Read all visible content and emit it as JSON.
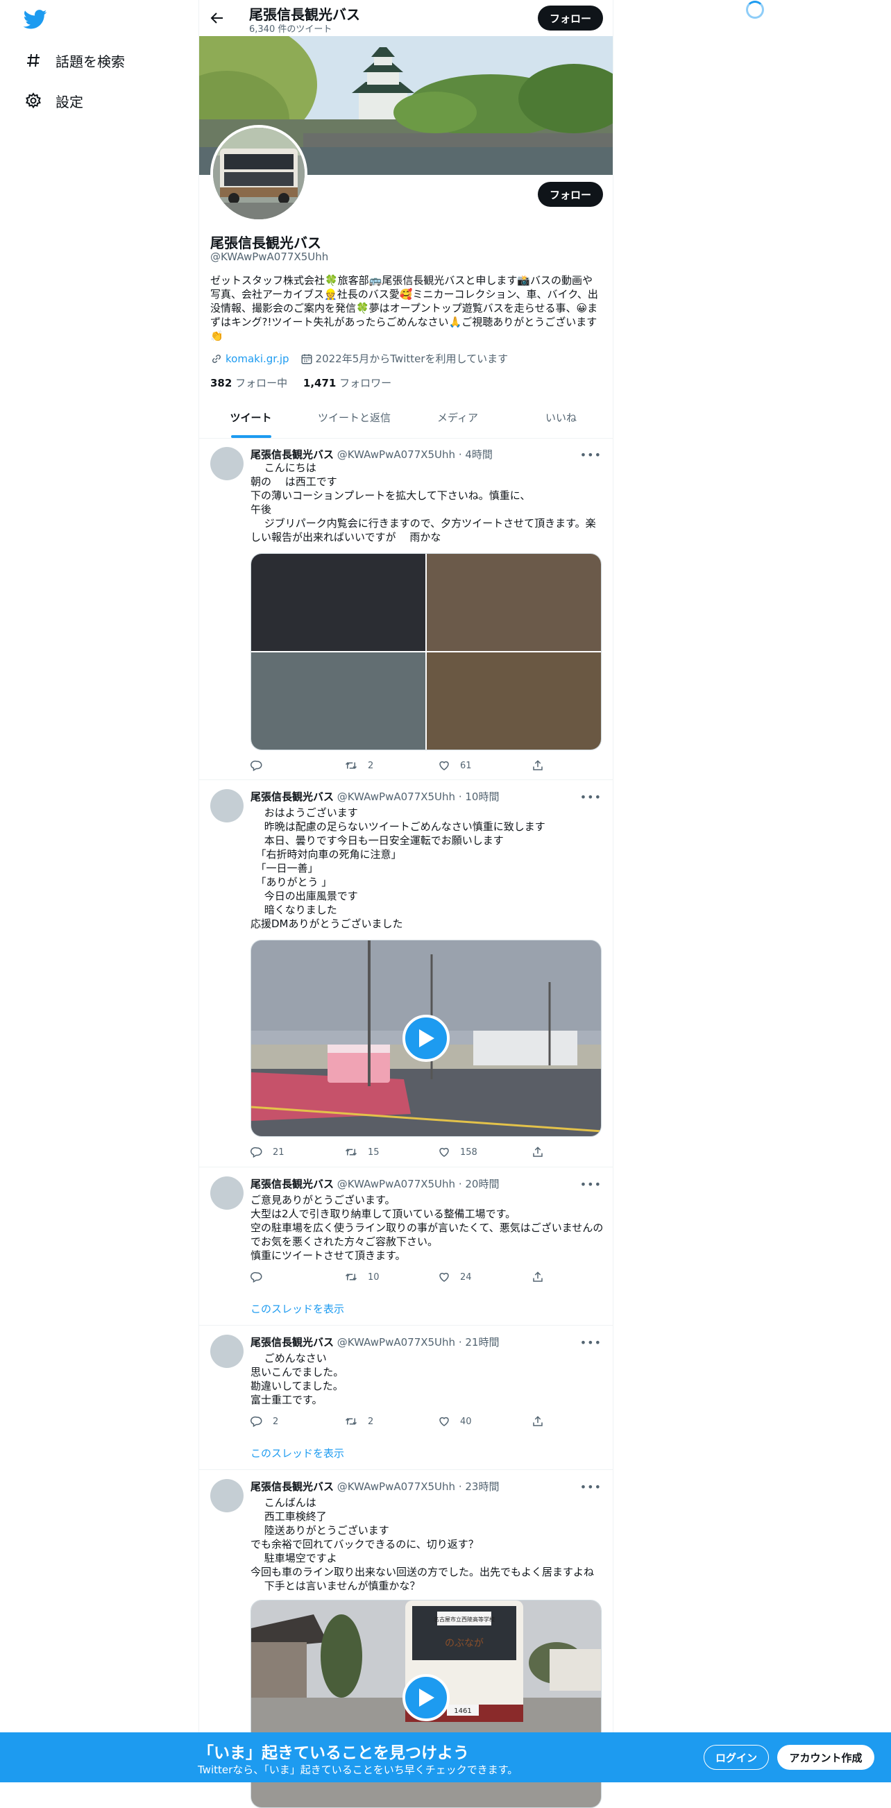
{
  "nav": {
    "explore": "話題を検索",
    "settings": "設定"
  },
  "header": {
    "title": "尾張信長観光バス",
    "tweet_count": "6,340 件のツイート",
    "follow_label": "フォロー"
  },
  "profile": {
    "follow_label": "フォロー",
    "name": "尾張信長観光バス",
    "handle": "@KWAwPwA077X5Uhh",
    "bio": "ゼットスタッフ株式会社🍀旅客部🚌尾張信長観光バスと申します📸バスの動画や写真、会社アーカイブス👷社長のバス愛🥰ミニカーコレクション、車、バイク、出没情報、撮影会のご案内を発信🍀夢はオープントップ遊覧バスを走らせる事、😀まずはキング?!ツイート失礼があったらごめんなさい🙏ご視聴ありがとうございます👏",
    "link": "komaki.gr.jp",
    "joined": "2022年5月からTwitterを利用しています",
    "following_count": "382",
    "following_label": "フォロー中",
    "followers_count": "1,471",
    "followers_label": "フォロワー"
  },
  "tabs": [
    "ツイート",
    "ツイートと返信",
    "メディア",
    "いいね"
  ],
  "tweets": [
    {
      "name": "尾張信長観光バス",
      "handle": "@KWAwPwA077X5Uhh",
      "time": "4時間",
      "text": "　 こんにちは\n朝の 　は西工です\n下の薄いコーションプレートを拡大して下さいね。慎重に、\n午後\n　 ジブリパーク内覧会に行きますので、夕方ツイートさせて頂きます。楽しい報告が出来ればいいですが　 雨かな",
      "replies": "",
      "retweets": "2",
      "likes": "61"
    },
    {
      "name": "尾張信長観光バス",
      "handle": "@KWAwPwA077X5Uhh",
      "time": "10時間",
      "text": "　 おはようございます\n　 昨晩は配慮の足らないツイートごめんなさい慎重に致します\n　 本日、曇りです今日も一日安全運転でお願いします\n　「右折時対向車の死角に注意」\n　「一日一善」\n　「ありがとう 」\n　 今日の出庫風景です\n　 暗くなりました\n応援DMありがとうございました",
      "replies": "21",
      "retweets": "15",
      "likes": "158"
    },
    {
      "name": "尾張信長観光バス",
      "handle": "@KWAwPwA077X5Uhh",
      "time": "20時間",
      "text": "ご意見ありがとうございます。\n大型は2人で引き取り納車して頂いている整備工場です。\n空の駐車場を広く使うライン取りの事が言いたくて、悪気はございませんのでお気を悪くされた方々ご容赦下さい。\n慎重にツイートさせて頂きます。",
      "replies": "",
      "retweets": "10",
      "likes": "24",
      "thread": "このスレッドを表示"
    },
    {
      "name": "尾張信長観光バス",
      "handle": "@KWAwPwA077X5Uhh",
      "time": "21時間",
      "text": "　 ごめんなさい\n思いこんでました。\n勘違いしてました。\n富士重工です。",
      "replies": "2",
      "retweets": "2",
      "likes": "40",
      "thread": "このスレッドを表示"
    },
    {
      "name": "尾張信長観光バス",
      "handle": "@KWAwPwA077X5Uhh",
      "time": "23時間",
      "text": "　 こんばんは\n　 西工車検終了\n　 陸送ありがとうございます\nでも余裕で回れてバックできるのに、切り返す？\n　 駐車場空ですよ\n今回も車のライン取り出来ない回送の方でした。出先でもよく居ますよね\n　 下手とは言いませんが慎重かな？",
      "video_sign": "名古屋市立西陵高等学校",
      "video_plate": "1461"
    }
  ],
  "bottom": {
    "title": "「いま」起きていることを見つけよう",
    "subtitle": "Twitterなら、「いま」起きていることをいち早くチェックできます。",
    "login": "ログイン",
    "signup": "アカウント作成"
  }
}
